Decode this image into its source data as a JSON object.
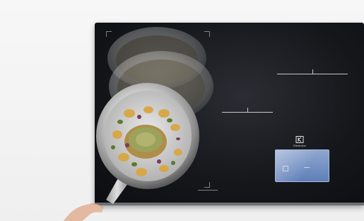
{
  "scene": {
    "background": "#f3f3f3",
    "cooktop_color": "#121418"
  },
  "cooktop": {
    "panel": {
      "brand_text": "Electrolux",
      "logo_icon": "electrolux-logo-icon"
    }
  }
}
